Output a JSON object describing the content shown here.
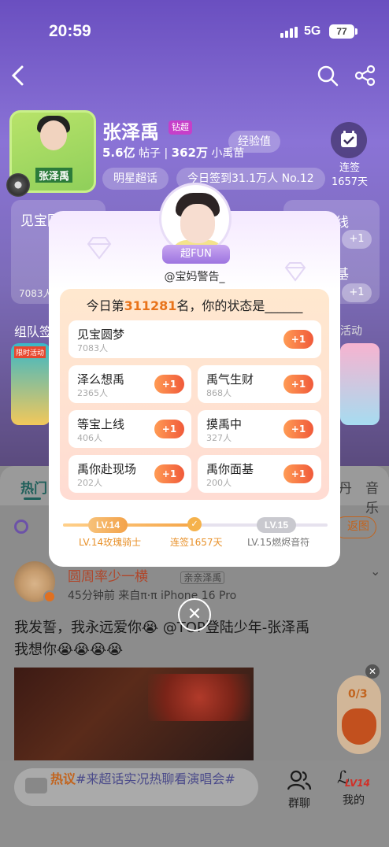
{
  "status": {
    "time": "20:59",
    "network": "5G",
    "battery": "77"
  },
  "header": {
    "name": "张泽禹",
    "badge": "钻超",
    "stats": {
      "posts_value": "5.6亿",
      "posts_label": "帖子",
      "fans_value": "362万",
      "fans_label": "小禹苗"
    },
    "exp_label": "经验值",
    "tag_star": "明星超话",
    "tag_checkin": "今日签到31.1万人 No.12",
    "sign": {
      "label": "连签",
      "days": "1657天"
    },
    "bg_card_left": "见宝圆",
    "bg_card_left_count": "7083人",
    "bg_card_right1": "线",
    "bg_card_right2": "基",
    "bg_plus": "+1",
    "team_label": "组队签",
    "activity_label": "活动",
    "thumb_left_label": "限时活动"
  },
  "modal": {
    "fun_badge": "超FUN",
    "username": "@宝妈警告_",
    "title_prefix": "今日第",
    "rank": "311281",
    "title_suffix": "名，你的状态是______",
    "states": [
      {
        "name": "见宝圆梦",
        "count": "7083人",
        "plus": "+1"
      },
      {
        "name": "泽么想禹",
        "count": "2365人",
        "plus": "+1"
      },
      {
        "name": "禹气生财",
        "count": "868人",
        "plus": "+1"
      },
      {
        "name": "等宝上线",
        "count": "406人",
        "plus": "+1"
      },
      {
        "name": "摸禹中",
        "count": "327人",
        "plus": "+1"
      },
      {
        "name": "禹你赴现场",
        "count": "202人",
        "plus": "+1"
      },
      {
        "name": "禹你面基",
        "count": "200人",
        "plus": "+1"
      }
    ],
    "level": {
      "current": "LV.14",
      "current_label": "LV.14玫瑰骑士",
      "streak_label": "连签1657天",
      "next": "LV.15",
      "next_label": "LV.15燃烬音符"
    }
  },
  "feed": {
    "tabs": [
      "热门",
      "丹",
      "音乐"
    ],
    "back_label": "返图",
    "post": {
      "user": "圆周率少一横",
      "fan_tag": "亲亲泽禹",
      "meta": "45分钟前  来自π·π iPhone 16 Pro",
      "line1": "我发誓，我永远爱你😭 @TOP登陆少年-张泽禹",
      "line2": "我想你😭😭😭😭"
    },
    "hot_tag": "热议",
    "hot_text": "#来超话实况热聊看演唱会#",
    "gift_count": "0/3",
    "group_chat": "群聊",
    "mine": "我的",
    "mine_level": "LV14"
  },
  "colors": {
    "accent": "#f5a64a",
    "brand_purple": "#9d74e0",
    "plus_red": "#f05a3a"
  }
}
